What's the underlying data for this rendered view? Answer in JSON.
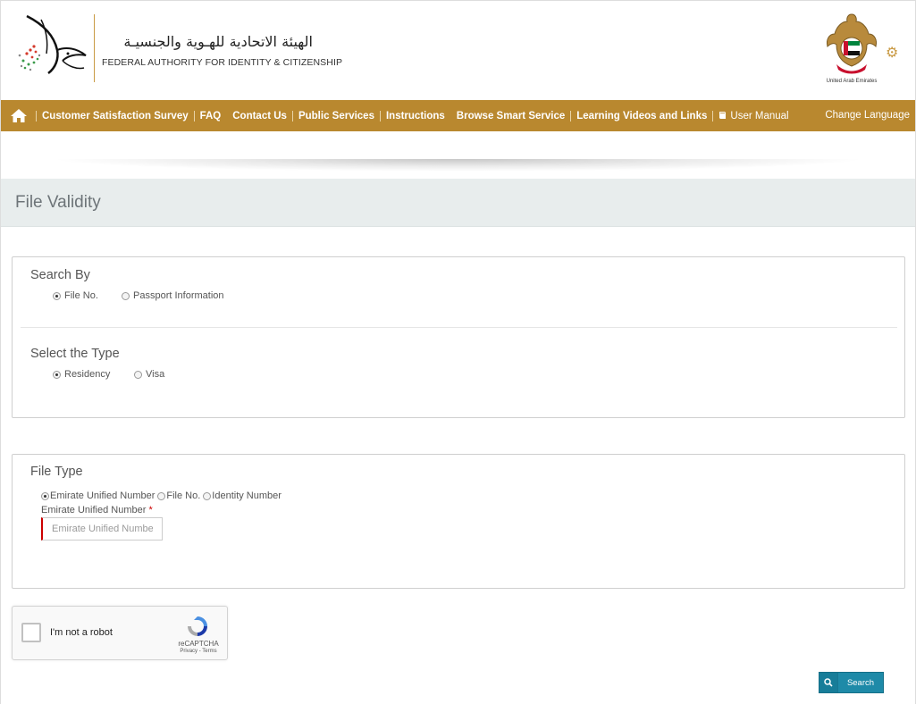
{
  "header": {
    "logo_arabic": "الهيئة الاتحادية للهـوية والجنسيـة",
    "logo_english": "FEDERAL AUTHORITY FOR IDENTITY & CITIZENSHIP",
    "emblem_caption": "United Arab Emirates",
    "settings_icon": "gear-icon"
  },
  "nav": {
    "home_icon": "home-icon",
    "items": [
      {
        "label": "Customer Satisfaction Survey"
      },
      {
        "label": "FAQ"
      },
      {
        "label": "Contact Us"
      },
      {
        "label": "Public Services"
      },
      {
        "label": "Instructions"
      },
      {
        "label": "Browse Smart Service"
      },
      {
        "label": "Learning Videos and Links"
      },
      {
        "label": "User Manual",
        "icon": "book-icon"
      }
    ],
    "change_language": "Change Language",
    "colors": {
      "background": "#b9882f",
      "text": "#ffffff"
    }
  },
  "page": {
    "title": "File Validity"
  },
  "search_by": {
    "title": "Search By",
    "options": [
      {
        "label": "File No.",
        "selected": true
      },
      {
        "label": "Passport Information",
        "selected": false
      }
    ]
  },
  "select_type": {
    "title": "Select the Type",
    "options": [
      {
        "label": "Residency",
        "selected": true
      },
      {
        "label": "Visa",
        "selected": false
      }
    ]
  },
  "file_type": {
    "title": "File Type",
    "options": [
      {
        "label": "Emirate Unified Number",
        "selected": true
      },
      {
        "label": "File No.",
        "selected": false
      },
      {
        "label": "Identity Number",
        "selected": false
      }
    ],
    "field_label": "Emirate Unified Number",
    "required_mark": "*",
    "field_value": "",
    "field_placeholder": "Emirate Unified Number"
  },
  "recaptcha": {
    "label": "I'm not a robot",
    "brand": "reCAPTCHA",
    "terms": "Privacy - Terms",
    "checked": false
  },
  "actions": {
    "search_label": "Search",
    "search_icon": "search-icon",
    "accent": "#1e8aa8"
  }
}
